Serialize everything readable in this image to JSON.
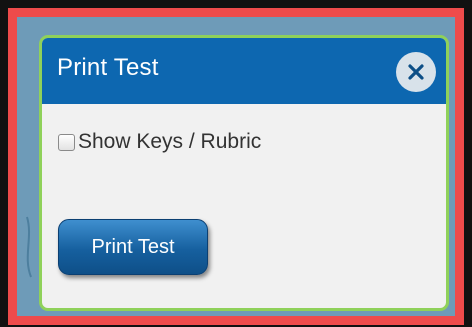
{
  "dialog": {
    "title": "Print Test",
    "close_icon": "close-icon",
    "show_keys_label": "Show Keys / Rubric",
    "show_keys_checked": false,
    "print_button_label": "Print Test"
  },
  "colors": {
    "highlight_border": "#ee4b4b",
    "header_background": "#0d67b0",
    "dialog_border": "#8fd15a",
    "button_blue": "#16609f"
  }
}
